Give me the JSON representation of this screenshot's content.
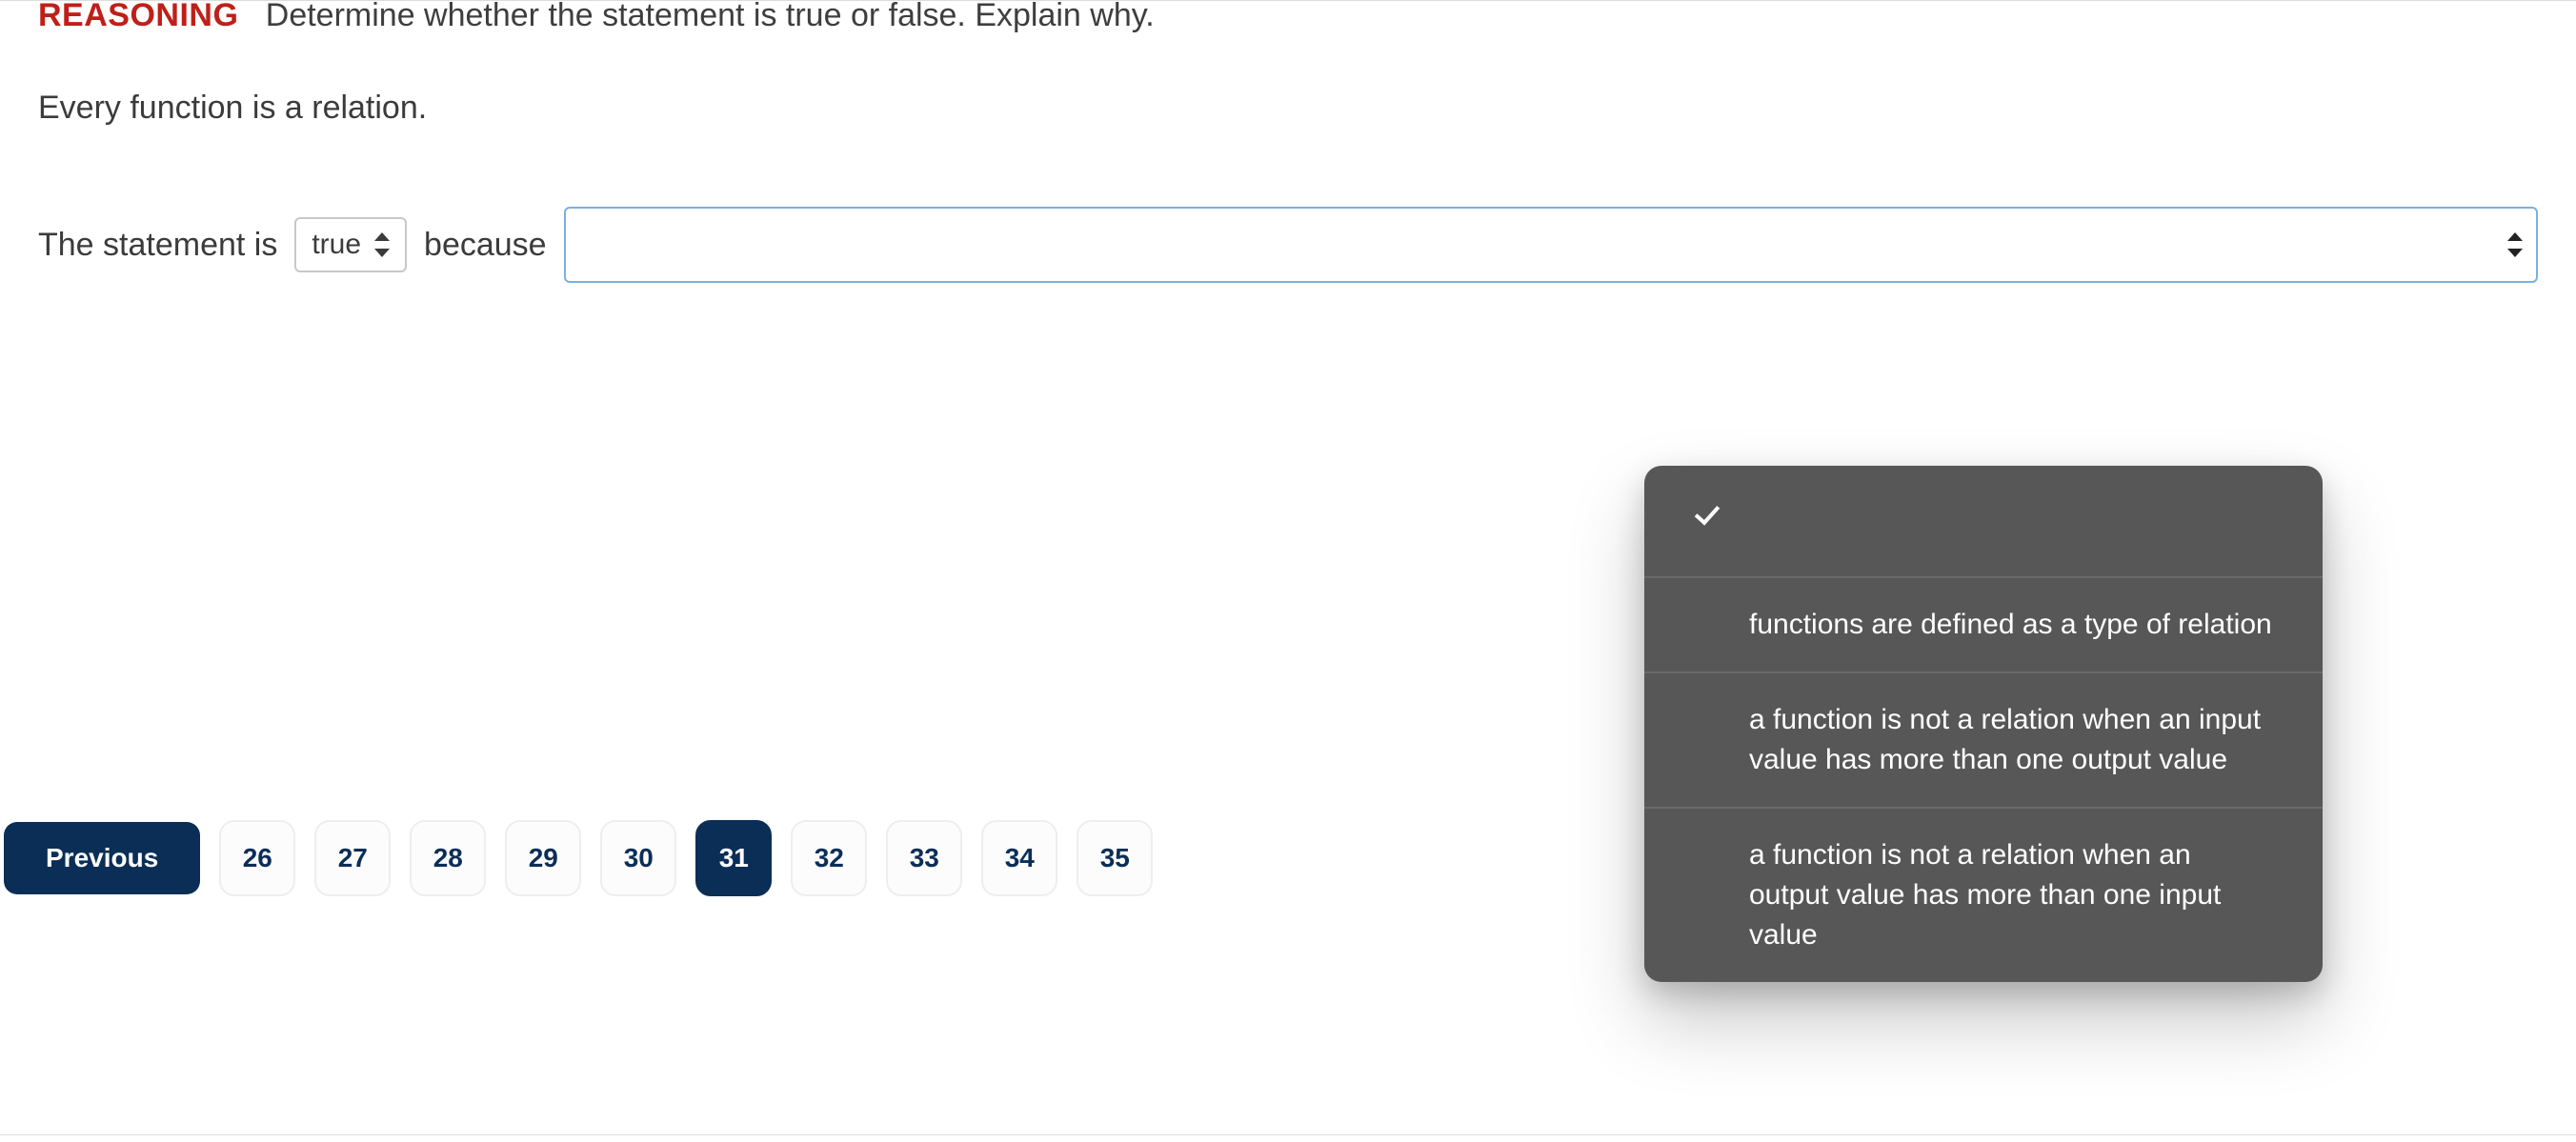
{
  "prompt": {
    "tag": "REASONING",
    "instruction": "Determine whether the statement is true or false. Explain why."
  },
  "statement": "Every function is a relation.",
  "answer": {
    "lead_in": "The statement is",
    "truth_select": {
      "value": "true"
    },
    "connector": "because",
    "reason_select": {
      "value": ""
    }
  },
  "dropdown": {
    "options": [
      "",
      "functions are defined as a type of relation",
      "a function is not a relation when an input value has more than one output value",
      "a function is not a relation when an output value has more than one input value"
    ]
  },
  "pagination": {
    "previous_label": "Previous",
    "pages": [
      "26",
      "27",
      "28",
      "29",
      "30",
      "31",
      "32",
      "33",
      "34",
      "35"
    ],
    "active": "31"
  }
}
